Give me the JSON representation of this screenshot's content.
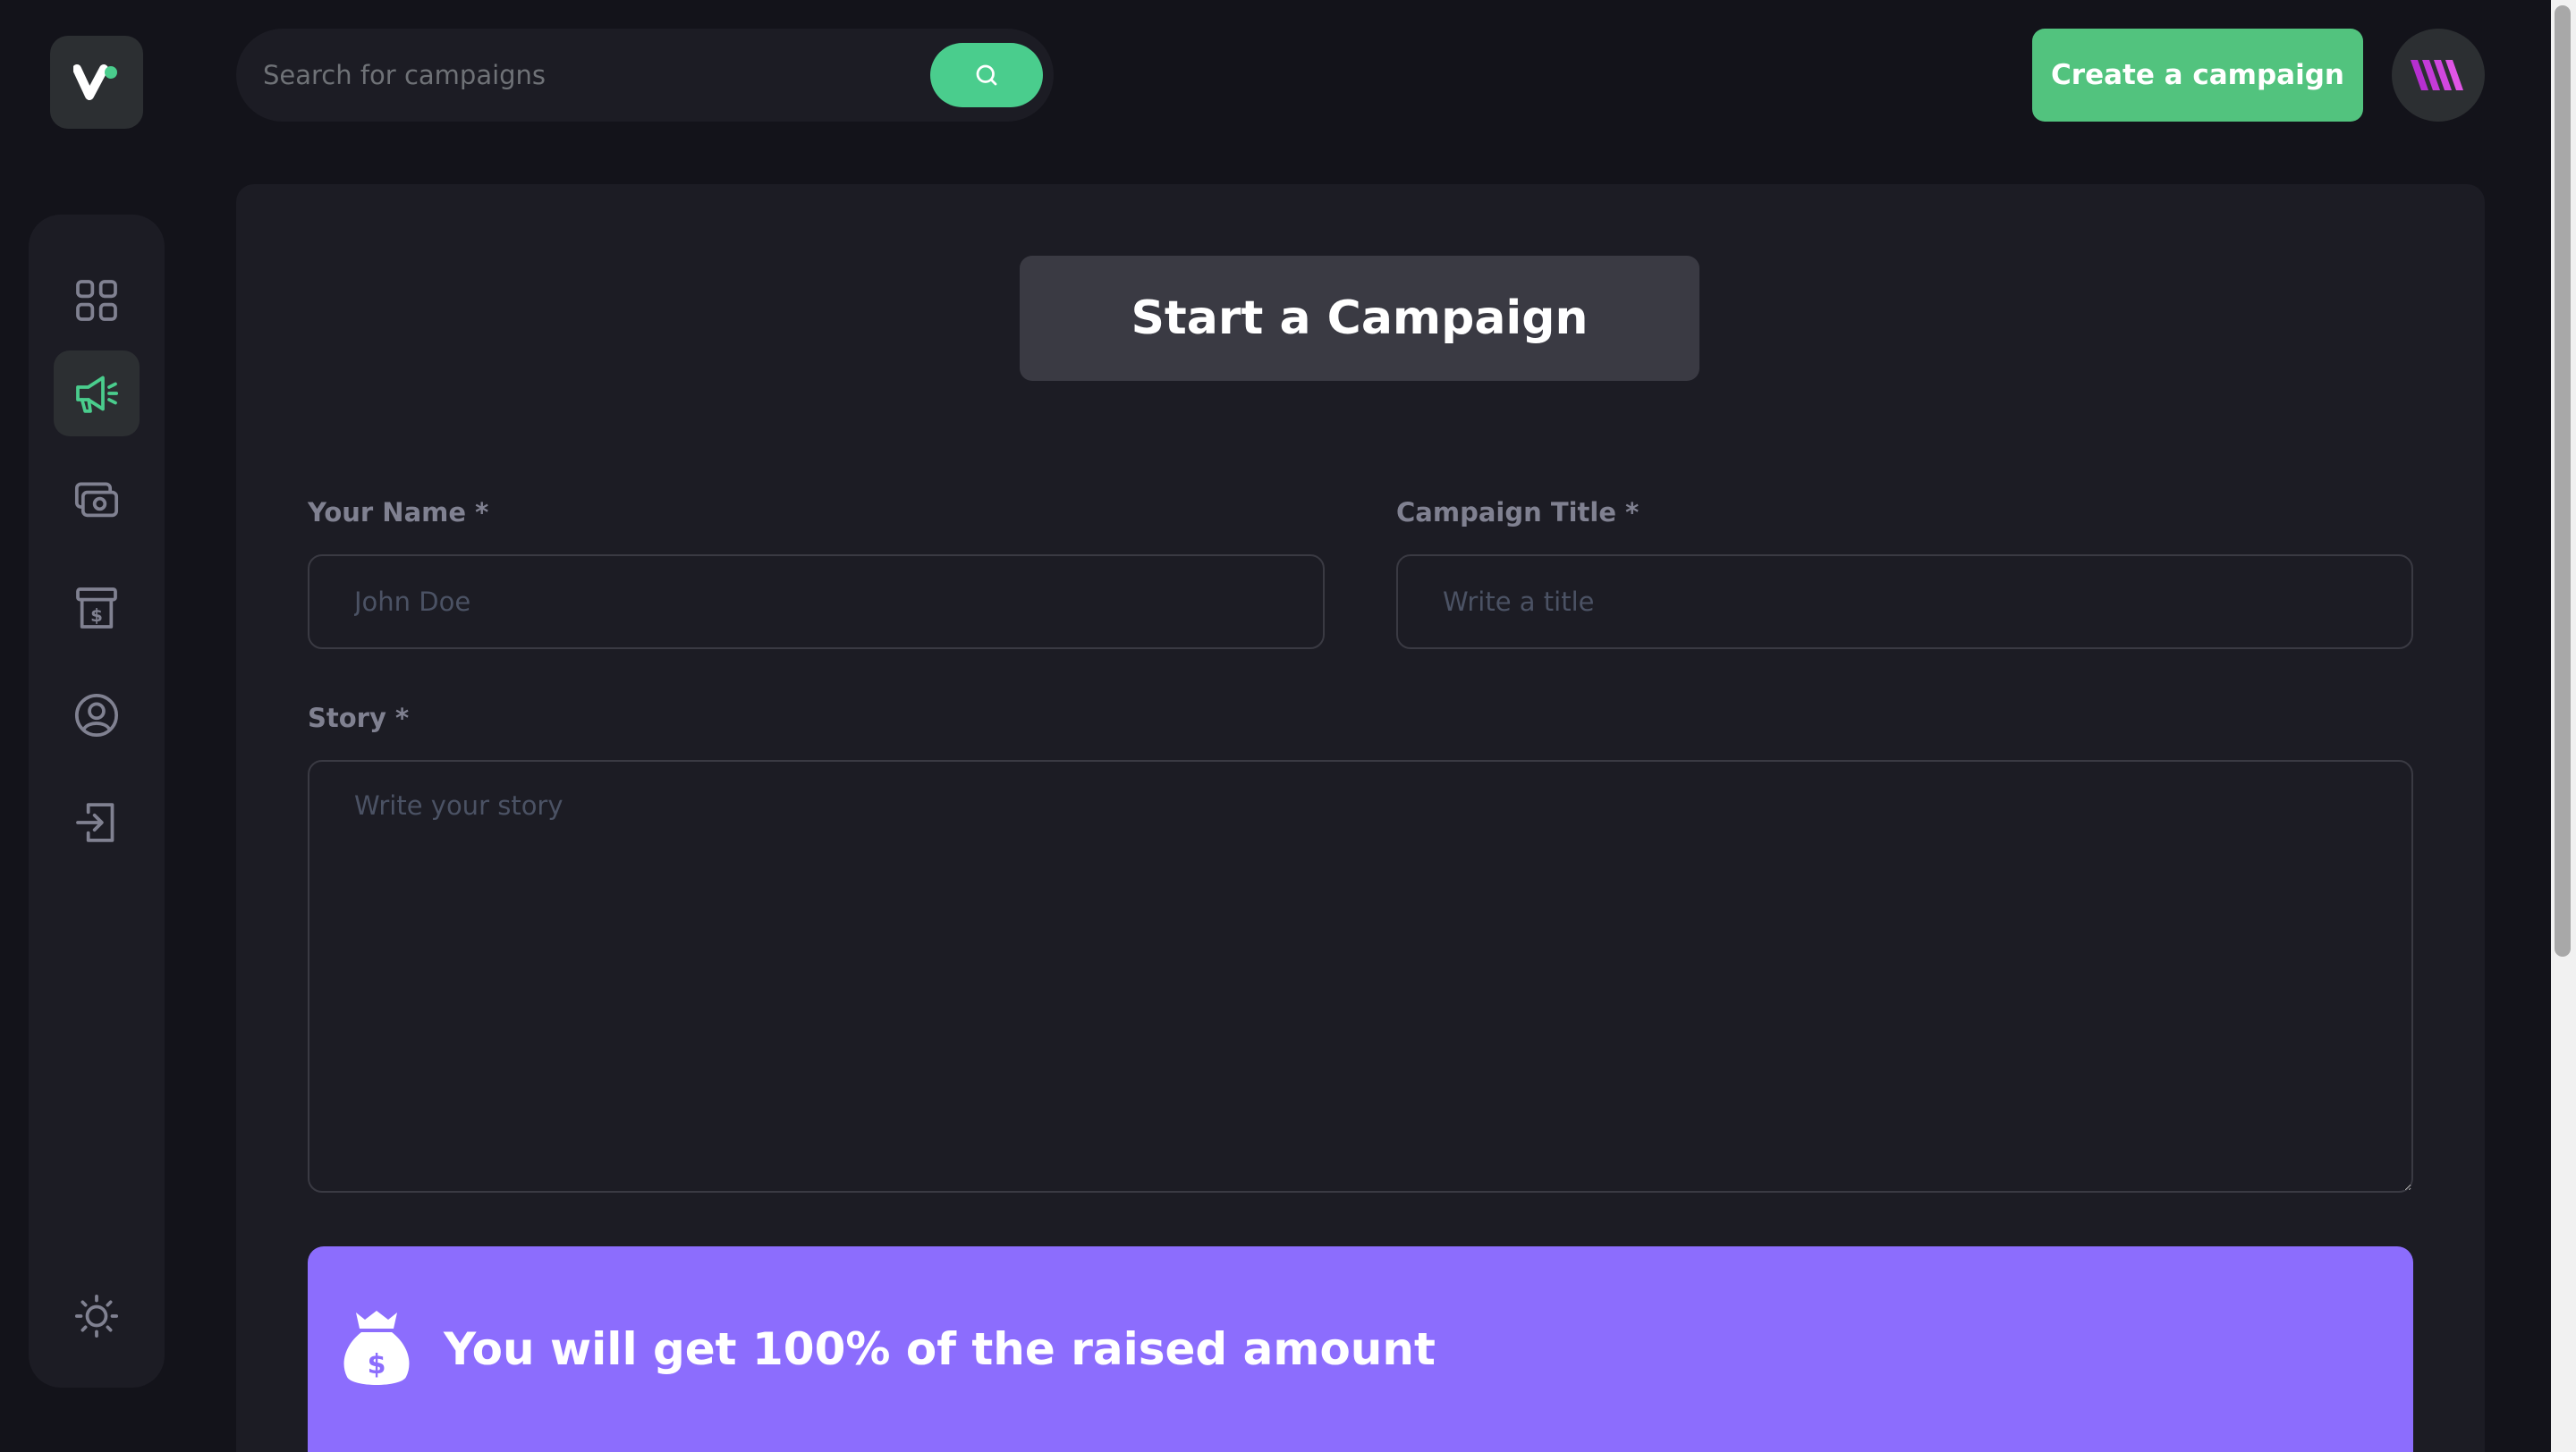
{
  "search": {
    "placeholder": "Search for campaigns"
  },
  "header": {
    "create_label": "Create a campaign"
  },
  "sidebar": {
    "items": [
      {
        "name": "dashboard",
        "icon": "dashboard-icon"
      },
      {
        "name": "campaign",
        "icon": "megaphone-icon",
        "active": true
      },
      {
        "name": "payment",
        "icon": "payment-icon"
      },
      {
        "name": "withdraw",
        "icon": "withdraw-icon"
      },
      {
        "name": "profile",
        "icon": "profile-icon"
      },
      {
        "name": "logout",
        "icon": "logout-icon"
      }
    ],
    "theme_icon": "sun-icon"
  },
  "form": {
    "title": "Start a Campaign",
    "name_label": "Your Name *",
    "name_placeholder": "John Doe",
    "title_label": "Campaign Title *",
    "title_placeholder": "Write a title",
    "story_label": "Story *",
    "story_placeholder": "Write your story"
  },
  "banner": {
    "text": "You will get 100% of the raised amount"
  },
  "colors": {
    "accent": "#4acd8d",
    "banner": "#8c6dfd",
    "background": "#13131a",
    "panel": "#1c1c24"
  }
}
